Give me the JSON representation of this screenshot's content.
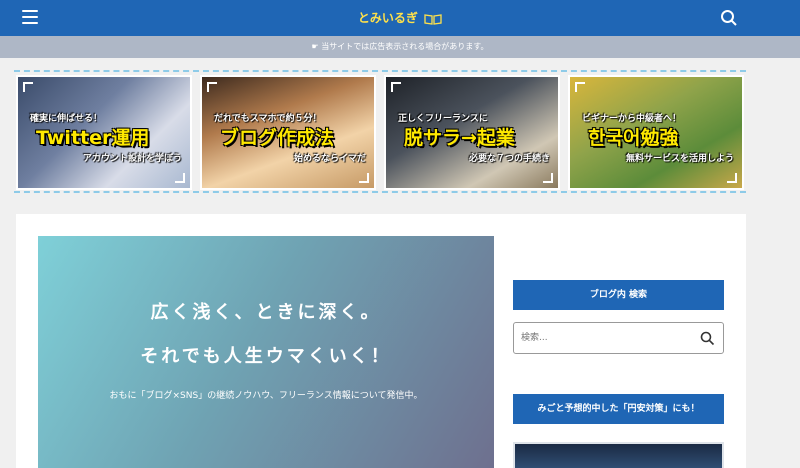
{
  "header": {
    "site_title": "とみいるぎ",
    "menu_icon": "hamburger-menu-icon",
    "logo_icon": "open-book-icon",
    "search_icon": "search-icon",
    "color": "#1f66b5"
  },
  "notice": {
    "text": "☛ 当サイトでは広告表示される場合があります。"
  },
  "banners": [
    {
      "top": "確実に伸ばせる！",
      "main": "Twitter運用",
      "sub": "アカウント設計を学ぼう"
    },
    {
      "top": "だれでもスマホで約５分！",
      "main": "ブログ作成法",
      "sub": "始めるならイマだ"
    },
    {
      "top": "正しくフリーランスに",
      "main": "脱サラ→起業",
      "sub": "必要な７つの手続き"
    },
    {
      "top": "ビギナーから中級者へ！",
      "main": "한국어勉強",
      "sub": "無料サービスを活用しよう"
    }
  ],
  "hero": {
    "line1": "広く浅く、ときに深く。",
    "line2": "それでも人生ウマくいく！",
    "desc": "おもに「ブログ×SNS」の継続ノウハウ、フリーランス情報について発信中。"
  },
  "sidebar": {
    "search_title": "ブログ内 検索",
    "search_placeholder": "検索...",
    "widget2_title": "みごと予想的中した「円安対策」にも！"
  }
}
